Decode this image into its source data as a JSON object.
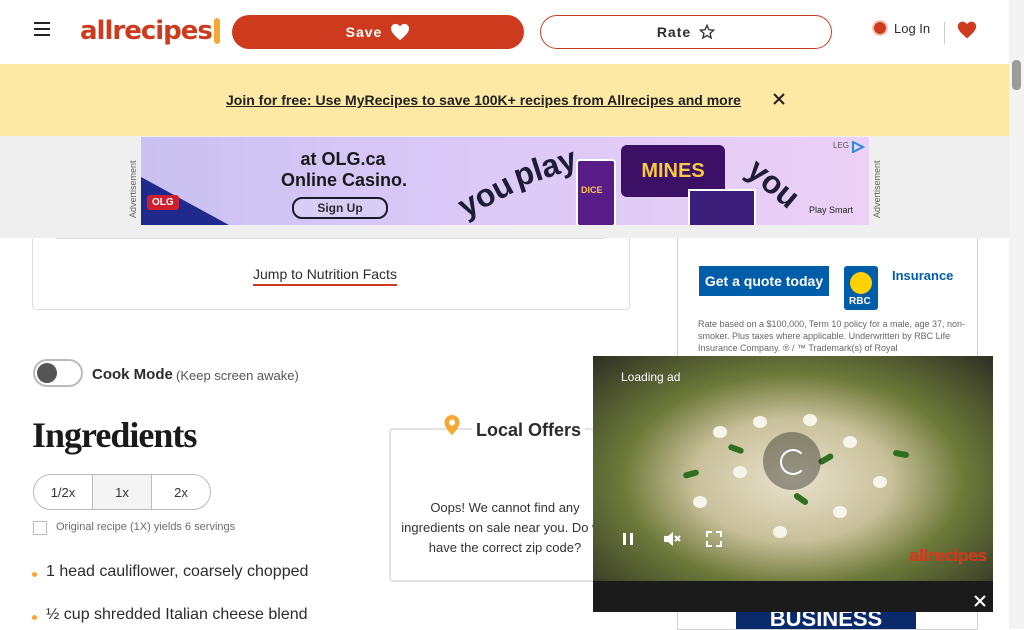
{
  "header": {
    "logo_text": "allrecipes",
    "save_label": "Save",
    "rate_label": "Rate",
    "login_label": "Log In"
  },
  "promo": {
    "text": "Join for free: Use MyRecipes to save 100K+ recipes from Allrecipes and more"
  },
  "ad_banner": {
    "advertisement_label": "Advertisement",
    "line1": "at OLG.ca",
    "line2": "Online Casino.",
    "signup": "Sign Up",
    "word_you": "you",
    "word_play": "play",
    "mines": "MINES",
    "dice": "DICE",
    "play_smart": "Play Smart",
    "leg": "LEG",
    "olg": "OLG"
  },
  "recipe": {
    "nutrition_link": "Jump to Nutrition Facts",
    "cook_mode_label": "Cook Mode",
    "cook_mode_sub": "(Keep screen awake)",
    "ingredients_title": "Ingredients",
    "servings_options": [
      "1/2x",
      "1x",
      "2x"
    ],
    "yield_text": "Original recipe (1X) yields 6 servings",
    "ingredients": [
      "1 head cauliflower, coarsely chopped",
      "½ cup shredded Italian cheese blend"
    ]
  },
  "local_offers": {
    "title": "Local Offers",
    "message": "Oops! We cannot find any ingredients on sale near you. Do we have the correct zip code?"
  },
  "right_ad": {
    "quote_button": "Get a quote today",
    "insurance": "Insurance",
    "fine_print": "Rate based on a $100,000, Term 10 policy for a male, age 37, non-smoker. Plus taxes where applicable. Underwritten by RBC Life Insurance Company. ® / ™ Trademark(s) of Royal",
    "rbc": "RBC",
    "business": "BUSINESS"
  },
  "video": {
    "loading_ad": "Loading ad",
    "watermark": "allrecipes"
  },
  "colors": {
    "brand_red": "#ce3a1d",
    "promo_yellow": "#fde9a4",
    "accent_orange": "#f8a733"
  }
}
